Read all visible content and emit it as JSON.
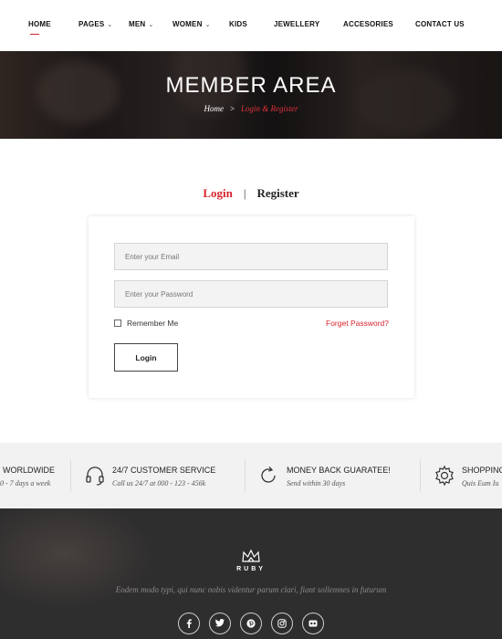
{
  "nav": {
    "items": [
      {
        "label": "HOME",
        "dropdown": false
      },
      {
        "label": "PAGES",
        "dropdown": true
      },
      {
        "label": "MEN",
        "dropdown": true
      },
      {
        "label": "WOMEN",
        "dropdown": true
      },
      {
        "label": "KIDS",
        "dropdown": false
      },
      {
        "label": "JEWELLERY",
        "dropdown": false
      },
      {
        "label": "ACCESORIES",
        "dropdown": false
      },
      {
        "label": "CONTACT US",
        "dropdown": false
      }
    ]
  },
  "hero": {
    "title": "MEMBER AREA",
    "breadcrumb": {
      "home": "Home",
      "separator": ">",
      "current": "Login & Register"
    }
  },
  "tabs": {
    "login": "Login",
    "divider": "|",
    "register": "Register"
  },
  "form": {
    "email_placeholder": "Enter your Email",
    "password_placeholder": "Enter your Password",
    "remember_label": "Remember Me",
    "forget_label": "Forget Password?",
    "login_button": "Login"
  },
  "features": [
    {
      "title": "WORLDWIDE",
      "subtitle": "0 - 7 days a week",
      "icon": "globe-icon"
    },
    {
      "title": "24/7 CUSTOMER SERVICE",
      "subtitle": "Call us 24/7 at 000 - 123 - 456k",
      "icon": "headset-icon"
    },
    {
      "title": "MONEY BACK GUARATEE!",
      "subtitle": "Send within 30 days",
      "icon": "refresh-icon"
    },
    {
      "title": "SHOPPING",
      "subtitle": "Quis Eum Iu",
      "icon": "gear-icon"
    }
  ],
  "footer": {
    "logo_text": "RUBY",
    "description": "Eodem modo typi, qui nunc nobis videntur parum clari, fiant sollemnes in futurum",
    "socials": [
      "facebook-icon",
      "twitter-icon",
      "pinterest-icon",
      "instagram-icon",
      "flickr-icon"
    ]
  },
  "colors": {
    "accent": "#d6242e",
    "footer_bg": "#2f2e2e",
    "features_bg": "#f2f2f2"
  }
}
